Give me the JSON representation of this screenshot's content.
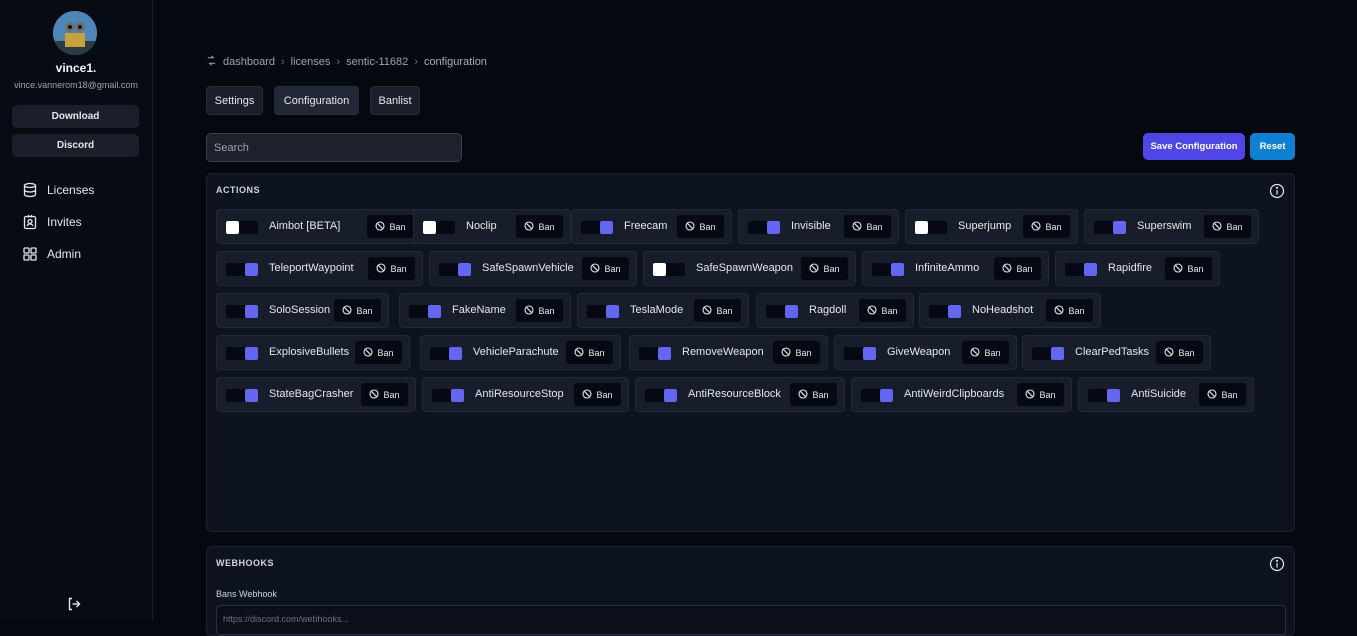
{
  "user": {
    "name": "vince1.",
    "email": "vince.vannerom18@gmail.com"
  },
  "sidebar": {
    "buttons": {
      "download": "Download",
      "discord": "Discord"
    },
    "nav": [
      {
        "label": "Licenses",
        "icon": "database-icon"
      },
      {
        "label": "Invites",
        "icon": "badge-icon"
      },
      {
        "label": "Admin",
        "icon": "grid-icon"
      }
    ],
    "logout_icon": "logout-icon"
  },
  "breadcrumb": [
    "dashboard",
    "licenses",
    "sentic-11682",
    "configuration"
  ],
  "tabs": [
    "Settings",
    "Configuration",
    "Banlist"
  ],
  "search": {
    "placeholder": "Search",
    "value": ""
  },
  "toolbar": {
    "save": "Save Configuration",
    "reset": "Reset"
  },
  "actions": {
    "title": "ACTIONS",
    "ban_label": "Ban",
    "items": [
      {
        "label": "Aimbot [BETA]",
        "enabled": false
      },
      {
        "label": "Noclip",
        "enabled": false
      },
      {
        "label": "Freecam",
        "enabled": true
      },
      {
        "label": "Invisible",
        "enabled": true
      },
      {
        "label": "Superjump",
        "enabled": false
      },
      {
        "label": "Superswim",
        "enabled": true
      },
      {
        "label": "TeleportWaypoint",
        "enabled": true
      },
      {
        "label": "SafeSpawnVehicle",
        "enabled": true
      },
      {
        "label": "SafeSpawnWeapon",
        "enabled": false
      },
      {
        "label": "InfiniteAmmo",
        "enabled": true
      },
      {
        "label": "Rapidfire",
        "enabled": true
      },
      {
        "label": "SoloSession",
        "enabled": true
      },
      {
        "label": "FakeName",
        "enabled": true
      },
      {
        "label": "TeslaMode",
        "enabled": true
      },
      {
        "label": "Ragdoll",
        "enabled": true
      },
      {
        "label": "NoHeadshot",
        "enabled": true
      },
      {
        "label": "ExplosiveBullets",
        "enabled": true
      },
      {
        "label": "VehicleParachute",
        "enabled": true
      },
      {
        "label": "RemoveWeapon",
        "enabled": true
      },
      {
        "label": "GiveWeapon",
        "enabled": true
      },
      {
        "label": "ClearPedTasks",
        "enabled": true
      },
      {
        "label": "StateBagCrasher",
        "enabled": true
      },
      {
        "label": "AntiResourceStop",
        "enabled": true
      },
      {
        "label": "AntiResourceBlock",
        "enabled": true
      },
      {
        "label": "AntiWeirdClipboards",
        "enabled": true
      },
      {
        "label": "AntiSuicide",
        "enabled": true
      }
    ]
  },
  "webhooks": {
    "title": "WEBHOOKS",
    "bans_label": "Bans Webhook",
    "bans_placeholder": "https://discord.com/webhooks..."
  },
  "colors": {
    "accent": "#6366f1",
    "save": "#4f46e5",
    "reset": "#0f7fd1"
  }
}
